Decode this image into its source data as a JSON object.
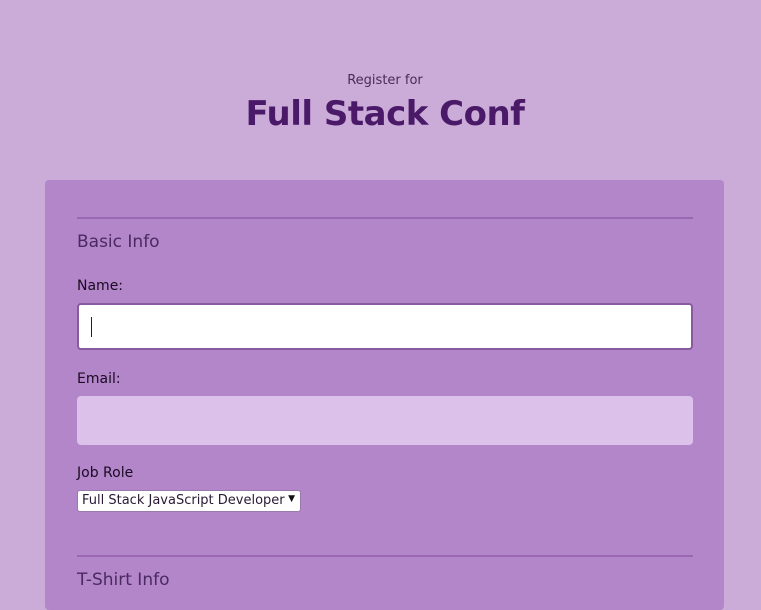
{
  "header": {
    "subtitle": "Register for",
    "title": "Full Stack Conf"
  },
  "basic_info": {
    "legend": "Basic Info",
    "name_label": "Name:",
    "name_value": "",
    "email_label": "Email:",
    "email_value": "",
    "job_role_label": "Job Role",
    "job_role_selected": "Full Stack JavaScript Developer"
  },
  "tshirt_info": {
    "legend": "T-Shirt Info"
  },
  "colors": {
    "page_background": "#cbacd9",
    "panel_background": "#b385c9",
    "title_color": "#4a1a68",
    "email_field_background": "#dcc1ea"
  },
  "icons": {
    "select_arrow": "chevron-down-icon"
  }
}
